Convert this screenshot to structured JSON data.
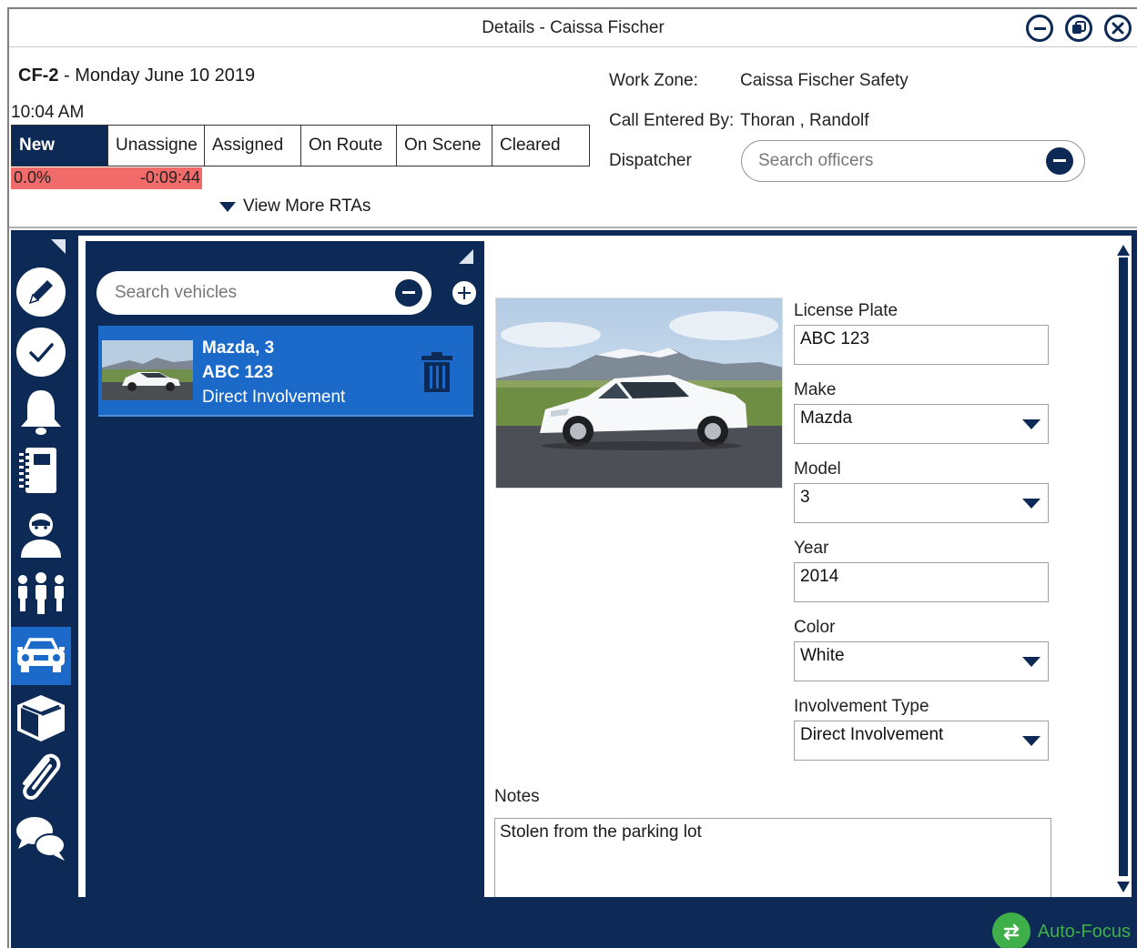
{
  "window": {
    "title": "Details - Caissa Fischer",
    "buttons": {
      "minimize": "minimize-icon",
      "restore": "restore-icon",
      "close": "close-icon"
    }
  },
  "call": {
    "id": "CF-2",
    "date": " - Monday June 10 2019",
    "time": "10:04 AM",
    "statuses": [
      "New",
      "Unassigne",
      "Assigned",
      "On Route",
      "On Scene",
      "Cleared"
    ],
    "active_status": "New",
    "timer": {
      "percent": "0.0%",
      "elapsed": "-0:09:44"
    },
    "view_more": "View More RTAs"
  },
  "info": {
    "work_zone_label": "Work Zone:",
    "work_zone_value": "Caissa Fischer Safety",
    "entered_by_label": "Call Entered By:",
    "entered_by_value": "Thoran , Randolf",
    "dispatcher_label": "Dispatcher",
    "officer_search_placeholder": "Search officers"
  },
  "sidebar": {
    "items": [
      {
        "icon": "pencil-icon"
      },
      {
        "icon": "checkmark-icon"
      },
      {
        "icon": "bell-icon"
      },
      {
        "icon": "notebook-icon"
      },
      {
        "icon": "person-icon"
      },
      {
        "icon": "people-group-icon"
      },
      {
        "icon": "car-icon",
        "active": true
      },
      {
        "icon": "box-icon"
      },
      {
        "icon": "paperclip-icon"
      },
      {
        "icon": "chat-bubbles-icon"
      }
    ]
  },
  "vehicles": {
    "search_placeholder": "Search vehicles",
    "list": [
      {
        "line1": "Mazda, 3",
        "line2": "ABC 123",
        "line3": "Direct Involvement"
      }
    ]
  },
  "form": {
    "license_plate_label": "License Plate",
    "license_plate": "ABC 123",
    "make_label": "Make",
    "make": "Mazda",
    "model_label": "Model",
    "model": "3",
    "year_label": "Year",
    "year": "2014",
    "color_label": "Color",
    "color": "White",
    "involvement_label": "Involvement Type",
    "involvement": "Direct Involvement",
    "notes_label": "Notes",
    "notes": "Stolen from the parking lot"
  },
  "footer": {
    "autofocus_label": "Auto-Focus"
  },
  "colors": {
    "navy": "#0c2a55",
    "active_blue": "#1b6ac9",
    "timer_red": "#f26b6b",
    "green": "#3fb049"
  }
}
